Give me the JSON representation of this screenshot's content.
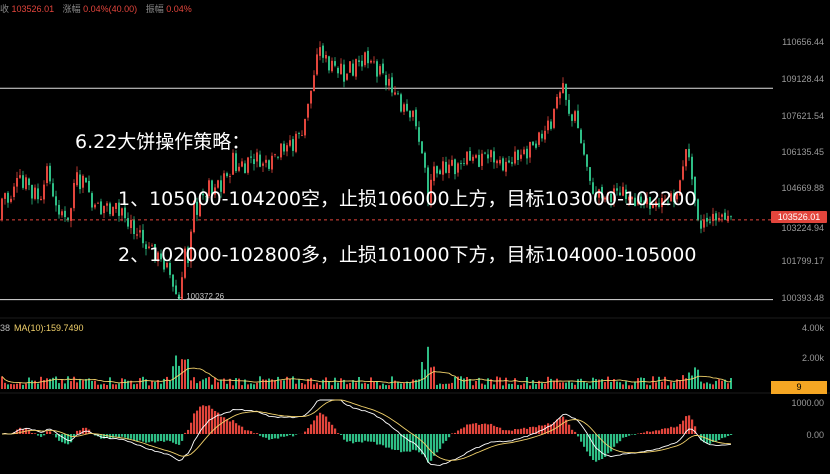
{
  "header": {
    "close_label": "收",
    "close_value": "103526.01",
    "change_label": "涨幅",
    "change_value": "0.04%(40.00)",
    "amplitude_label": "振幅",
    "amplitude_value": "0.04%"
  },
  "strategy": {
    "title": "6.22大饼操作策略：",
    "line1": "1、105000-104200空，止损106000上方，目标103000-102200",
    "line2": "2、102000-102800多，止损101000下方，目标104000-105000"
  },
  "price_axis": [
    "110656.44",
    "109128.44",
    "107621.54",
    "106135.45",
    "104669.88",
    "103224.94",
    "101799.17",
    "100393.48"
  ],
  "current_price": "103526.01",
  "low_marker": "← 100372.26",
  "volume": {
    "ma_prefix": "38",
    "ma_label": "MA(10):159.7490",
    "axis": [
      "4.00k",
      "2.00k"
    ],
    "badge": "9"
  },
  "macd": {
    "axis": [
      "1000.00",
      "0.00"
    ]
  },
  "colors": {
    "up": "#e2453c",
    "down": "#2ebd85",
    "ma": "#f0d06a",
    "horizontal_line": "#e0e0e0",
    "price_line": "#e2453c"
  },
  "chart_data": {
    "type": "candlestick",
    "ylim": [
      100393.48,
      110656.44
    ],
    "ticks": [
      110656.44,
      109128.44,
      107621.54,
      106135.45,
      104669.88,
      103224.94,
      101799.17,
      100393.48
    ],
    "horizontal_lines": [
      108800,
      100330
    ],
    "price_path": [
      [
        0,
        104300
      ],
      [
        4,
        104600
      ],
      [
        8,
        104100
      ],
      [
        13,
        104900
      ],
      [
        18,
        105500
      ],
      [
        22,
        104800
      ],
      [
        26,
        105300
      ],
      [
        31,
        104400
      ],
      [
        35,
        104900
      ],
      [
        38,
        104100
      ],
      [
        42,
        104700
      ],
      [
        46,
        105700
      ],
      [
        50,
        104800
      ],
      [
        54,
        104200
      ],
      [
        58,
        103700
      ],
      [
        62,
        104000
      ],
      [
        66,
        103300
      ],
      [
        70,
        104000
      ],
      [
        75,
        105600
      ],
      [
        79,
        104800
      ],
      [
        83,
        105400
      ],
      [
        88,
        104600
      ],
      [
        92,
        103900
      ],
      [
        96,
        104400
      ],
      [
        100,
        103800
      ],
      [
        105,
        104300
      ],
      [
        110,
        103600
      ],
      [
        114,
        104400
      ],
      [
        118,
        103700
      ],
      [
        122,
        104100
      ],
      [
        126,
        103100
      ],
      [
        130,
        103500
      ],
      [
        134,
        102700
      ],
      [
        138,
        103300
      ],
      [
        142,
        102600
      ],
      [
        146,
        102300
      ],
      [
        150,
        102700
      ],
      [
        154,
        101900
      ],
      [
        158,
        102300
      ],
      [
        162,
        101500
      ],
      [
        166,
        101800
      ],
      [
        170,
        101200
      ],
      [
        174,
        100600
      ],
      [
        178,
        100372.26
      ],
      [
        181,
        101200
      ],
      [
        184,
        102400
      ],
      [
        187,
        101800
      ],
      [
        190,
        103000
      ],
      [
        193,
        104300
      ],
      [
        196,
        103700
      ],
      [
        200,
        104800
      ],
      [
        204,
        104200
      ],
      [
        208,
        105100
      ],
      [
        212,
        104300
      ],
      [
        216,
        105300
      ],
      [
        220,
        104600
      ],
      [
        224,
        105600
      ],
      [
        228,
        105000
      ],
      [
        232,
        106200
      ],
      [
        236,
        105300
      ],
      [
        240,
        106000
      ],
      [
        244,
        105400
      ],
      [
        248,
        106300
      ],
      [
        252,
        105700
      ],
      [
        256,
        106200
      ],
      [
        260,
        105500
      ],
      [
        264,
        106100
      ],
      [
        268,
        105600
      ],
      [
        272,
        106300
      ],
      [
        276,
        105900
      ],
      [
        280,
        106600
      ],
      [
        284,
        106100
      ],
      [
        288,
        106900
      ],
      [
        292,
        106300
      ],
      [
        296,
        107200
      ],
      [
        300,
        106700
      ],
      [
        304,
        107600
      ],
      [
        307,
        108200
      ],
      [
        310,
        108700
      ],
      [
        314,
        109500
      ],
      [
        318,
        110750
      ],
      [
        321,
        109900
      ],
      [
        324,
        110300
      ],
      [
        328,
        109500
      ],
      [
        332,
        110100
      ],
      [
        336,
        109200
      ],
      [
        340,
        109800
      ],
      [
        344,
        108900
      ],
      [
        348,
        110000
      ],
      [
        352,
        109300
      ],
      [
        356,
        110200
      ],
      [
        360,
        109500
      ],
      [
        364,
        110300
      ],
      [
        368,
        109600
      ],
      [
        372,
        110100
      ],
      [
        376,
        109300
      ],
      [
        380,
        109900
      ],
      [
        384,
        108800
      ],
      [
        388,
        109200
      ],
      [
        392,
        108400
      ],
      [
        396,
        108800
      ],
      [
        400,
        107900
      ],
      [
        404,
        108300
      ],
      [
        408,
        107600
      ],
      [
        412,
        107900
      ],
      [
        416,
        107000
      ],
      [
        420,
        106400
      ],
      [
        424,
        105600
      ],
      [
        427,
        104200
      ],
      [
        430,
        105100
      ],
      [
        434,
        105800
      ],
      [
        438,
        105100
      ],
      [
        442,
        105900
      ],
      [
        446,
        105300
      ],
      [
        450,
        106100
      ],
      [
        454,
        105400
      ],
      [
        458,
        106000
      ],
      [
        462,
        105600
      ],
      [
        466,
        106300
      ],
      [
        470,
        105800
      ],
      [
        474,
        106200
      ],
      [
        478,
        105700
      ],
      [
        482,
        106400
      ],
      [
        486,
        105900
      ],
      [
        490,
        106300
      ],
      [
        494,
        105600
      ],
      [
        498,
        106100
      ],
      [
        502,
        105500
      ],
      [
        506,
        106000
      ],
      [
        510,
        105600
      ],
      [
        514,
        106300
      ],
      [
        518,
        105800
      ],
      [
        522,
        106500
      ],
      [
        526,
        106000
      ],
      [
        530,
        106800
      ],
      [
        534,
        106300
      ],
      [
        538,
        107000
      ],
      [
        542,
        106700
      ],
      [
        546,
        107600
      ],
      [
        550,
        107200
      ],
      [
        554,
        108300
      ],
      [
        558,
        108500
      ],
      [
        562,
        108950
      ],
      [
        566,
        108100
      ],
      [
        570,
        107400
      ],
      [
        574,
        107900
      ],
      [
        578,
        106900
      ],
      [
        582,
        106300
      ],
      [
        586,
        105600
      ],
      [
        590,
        104900
      ],
      [
        594,
        104300
      ],
      [
        598,
        104800
      ],
      [
        602,
        104200
      ],
      [
        606,
        104700
      ],
      [
        610,
        104300
      ],
      [
        614,
        104900
      ],
      [
        618,
        104400
      ],
      [
        622,
        104800
      ],
      [
        626,
        104200
      ],
      [
        630,
        104600
      ],
      [
        634,
        104100
      ],
      [
        638,
        104500
      ],
      [
        642,
        104000
      ],
      [
        646,
        104400
      ],
      [
        650,
        103900
      ],
      [
        654,
        104300
      ],
      [
        658,
        104000
      ],
      [
        662,
        104500
      ],
      [
        666,
        104100
      ],
      [
        670,
        104600
      ],
      [
        674,
        104200
      ],
      [
        678,
        104900
      ],
      [
        682,
        105700
      ],
      [
        685,
        106400
      ],
      [
        688,
        106000
      ],
      [
        691,
        105200
      ],
      [
        694,
        104300
      ],
      [
        697,
        103500
      ],
      [
        700,
        103200
      ],
      [
        704,
        103700
      ],
      [
        708,
        103300
      ],
      [
        712,
        103800
      ],
      [
        716,
        103400
      ],
      [
        720,
        103900
      ],
      [
        724,
        103500
      ],
      [
        728,
        103800
      ],
      [
        732,
        103526.01
      ]
    ]
  }
}
